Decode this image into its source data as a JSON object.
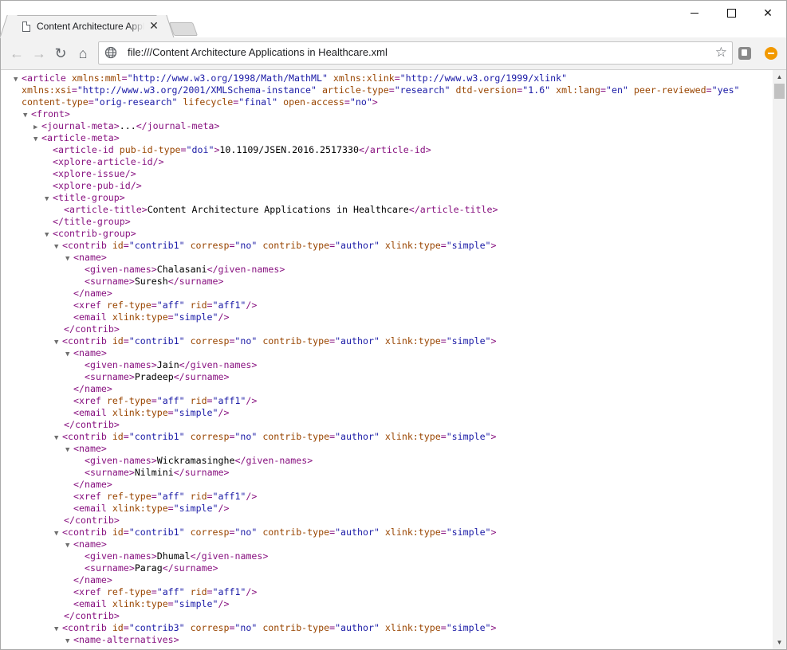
{
  "browser": {
    "tab_title": "Content Architecture Applications in Healthcare.xml",
    "tab_close_glyph": "✕",
    "url": "file:///Content Architecture Applications in Healthcare.xml",
    "star_glyph": "☆",
    "back_glyph": "←",
    "forward_glyph": "→",
    "reload_glyph": "↻",
    "home_glyph": "⌂",
    "close_glyph": "✕",
    "icons": [
      "page-icon",
      "globe-icon",
      "star-icon",
      "extension-icon",
      "orange-extension-icon"
    ]
  },
  "colors": {
    "tag": "#881280",
    "attr_name": "#994500",
    "attr_value": "#1a1aa6",
    "toggle": "#6e6e6e"
  },
  "xml_lines": [
    {
      "toggle": "▼",
      "parts": [
        [
          "t",
          "<article"
        ],
        [
          "a",
          " xmlns:mml"
        ],
        [
          "t",
          "="
        ],
        [
          "v",
          "\"http://www.w3.org/1998/Math/MathML\""
        ],
        [
          "a",
          " xmlns:xlink"
        ],
        [
          "t",
          "="
        ],
        [
          "v",
          "\"http://www.w3.org/1999/xlink\""
        ]
      ]
    },
    {
      "toggle": "",
      "parts": [
        [
          "a",
          "xmlns:xsi"
        ],
        [
          "t",
          "="
        ],
        [
          "v",
          "\"http://www.w3.org/2001/XMLSchema-instance\""
        ],
        [
          "a",
          " article-type"
        ],
        [
          "t",
          "="
        ],
        [
          "v",
          "\"research\""
        ],
        [
          "a",
          " dtd-version"
        ],
        [
          "t",
          "="
        ],
        [
          "v",
          "\"1.6\""
        ],
        [
          "a",
          " xml:lang"
        ],
        [
          "t",
          "="
        ],
        [
          "v",
          "\"en\""
        ],
        [
          "a",
          " peer-reviewed"
        ],
        [
          "t",
          "="
        ],
        [
          "v",
          "\"yes\""
        ]
      ]
    },
    {
      "toggle": "",
      "parts": [
        [
          "a",
          "content-type"
        ],
        [
          "t",
          "="
        ],
        [
          "v",
          "\"orig-research\""
        ],
        [
          "a",
          " lifecycle"
        ],
        [
          "t",
          "="
        ],
        [
          "v",
          "\"final\""
        ],
        [
          "a",
          " open-access"
        ],
        [
          "t",
          "="
        ],
        [
          "v",
          "\"no\""
        ],
        [
          "t",
          ">"
        ]
      ]
    },
    {
      "toggle": "▼",
      "parts": [
        [
          "t",
          "<front>"
        ]
      ]
    },
    {
      "toggle": "▶",
      "parts": [
        [
          "t",
          "<journal-meta>"
        ],
        [
          "x",
          "..."
        ],
        [
          "t",
          "</journal-meta>"
        ]
      ]
    },
    {
      "toggle": "▼",
      "parts": [
        [
          "t",
          "<article-meta>"
        ]
      ]
    },
    {
      "toggle": "",
      "parts": [
        [
          "t",
          "<article-id"
        ],
        [
          "a",
          " pub-id-type"
        ],
        [
          "t",
          "="
        ],
        [
          "v",
          "\"doi\""
        ],
        [
          "t",
          ">"
        ],
        [
          "x",
          "10.1109/JSEN.2016.2517330"
        ],
        [
          "t",
          "</article-id>"
        ]
      ]
    },
    {
      "toggle": "",
      "parts": [
        [
          "t",
          "<xplore-article-id/>"
        ]
      ]
    },
    {
      "toggle": "",
      "parts": [
        [
          "t",
          "<xplore-issue/>"
        ]
      ]
    },
    {
      "toggle": "",
      "parts": [
        [
          "t",
          "<xplore-pub-id/>"
        ]
      ]
    },
    {
      "toggle": "▼",
      "parts": [
        [
          "t",
          "<title-group>"
        ]
      ]
    },
    {
      "toggle": "",
      "parts": [
        [
          "t",
          "<article-title>"
        ],
        [
          "x",
          "Content Architecture Applications in Healthcare"
        ],
        [
          "t",
          "</article-title>"
        ]
      ]
    },
    {
      "toggle": "",
      "parts": [
        [
          "t",
          "</title-group>"
        ]
      ]
    },
    {
      "toggle": "▼",
      "parts": [
        [
          "t",
          "<contrib-group>"
        ]
      ]
    },
    {
      "toggle": "▼",
      "parts": [
        [
          "t",
          "<contrib"
        ],
        [
          "a",
          " id"
        ],
        [
          "t",
          "="
        ],
        [
          "v",
          "\"contrib1\""
        ],
        [
          "a",
          " corresp"
        ],
        [
          "t",
          "="
        ],
        [
          "v",
          "\"no\""
        ],
        [
          "a",
          " contrib-type"
        ],
        [
          "t",
          "="
        ],
        [
          "v",
          "\"author\""
        ],
        [
          "a",
          " xlink:type"
        ],
        [
          "t",
          "="
        ],
        [
          "v",
          "\"simple\""
        ],
        [
          "t",
          ">"
        ]
      ]
    },
    {
      "toggle": "▼",
      "parts": [
        [
          "t",
          "<name>"
        ]
      ]
    },
    {
      "toggle": "",
      "parts": [
        [
          "t",
          "<given-names>"
        ],
        [
          "x",
          "Chalasani"
        ],
        [
          "t",
          "</given-names>"
        ]
      ]
    },
    {
      "toggle": "",
      "parts": [
        [
          "t",
          "<surname>"
        ],
        [
          "x",
          "Suresh"
        ],
        [
          "t",
          "</surname>"
        ]
      ]
    },
    {
      "toggle": "",
      "parts": [
        [
          "t",
          "</name>"
        ]
      ]
    },
    {
      "toggle": "",
      "parts": [
        [
          "t",
          "<xref"
        ],
        [
          "a",
          " ref-type"
        ],
        [
          "t",
          "="
        ],
        [
          "v",
          "\"aff\""
        ],
        [
          "a",
          " rid"
        ],
        [
          "t",
          "="
        ],
        [
          "v",
          "\"aff1\""
        ],
        [
          "t",
          "/>"
        ]
      ]
    },
    {
      "toggle": "",
      "parts": [
        [
          "t",
          "<email"
        ],
        [
          "a",
          " xlink:type"
        ],
        [
          "t",
          "="
        ],
        [
          "v",
          "\"simple\""
        ],
        [
          "t",
          "/>"
        ]
      ]
    },
    {
      "toggle": "",
      "parts": [
        [
          "t",
          "</contrib>"
        ]
      ]
    },
    {
      "toggle": "▼",
      "parts": [
        [
          "t",
          "<contrib"
        ],
        [
          "a",
          " id"
        ],
        [
          "t",
          "="
        ],
        [
          "v",
          "\"contrib1\""
        ],
        [
          "a",
          " corresp"
        ],
        [
          "t",
          "="
        ],
        [
          "v",
          "\"no\""
        ],
        [
          "a",
          " contrib-type"
        ],
        [
          "t",
          "="
        ],
        [
          "v",
          "\"author\""
        ],
        [
          "a",
          " xlink:type"
        ],
        [
          "t",
          "="
        ],
        [
          "v",
          "\"simple\""
        ],
        [
          "t",
          ">"
        ]
      ]
    },
    {
      "toggle": "▼",
      "parts": [
        [
          "t",
          "<name>"
        ]
      ]
    },
    {
      "toggle": "",
      "parts": [
        [
          "t",
          "<given-names>"
        ],
        [
          "x",
          "Jain"
        ],
        [
          "t",
          "</given-names>"
        ]
      ]
    },
    {
      "toggle": "",
      "parts": [
        [
          "t",
          "<surname>"
        ],
        [
          "x",
          "Pradeep"
        ],
        [
          "t",
          "</surname>"
        ]
      ]
    },
    {
      "toggle": "",
      "parts": [
        [
          "t",
          "</name>"
        ]
      ]
    },
    {
      "toggle": "",
      "parts": [
        [
          "t",
          "<xref"
        ],
        [
          "a",
          " ref-type"
        ],
        [
          "t",
          "="
        ],
        [
          "v",
          "\"aff\""
        ],
        [
          "a",
          " rid"
        ],
        [
          "t",
          "="
        ],
        [
          "v",
          "\"aff1\""
        ],
        [
          "t",
          "/>"
        ]
      ]
    },
    {
      "toggle": "",
      "parts": [
        [
          "t",
          "<email"
        ],
        [
          "a",
          " xlink:type"
        ],
        [
          "t",
          "="
        ],
        [
          "v",
          "\"simple\""
        ],
        [
          "t",
          "/>"
        ]
      ]
    },
    {
      "toggle": "",
      "parts": [
        [
          "t",
          "</contrib>"
        ]
      ]
    },
    {
      "toggle": "▼",
      "parts": [
        [
          "t",
          "<contrib"
        ],
        [
          "a",
          " id"
        ],
        [
          "t",
          "="
        ],
        [
          "v",
          "\"contrib1\""
        ],
        [
          "a",
          " corresp"
        ],
        [
          "t",
          "="
        ],
        [
          "v",
          "\"no\""
        ],
        [
          "a",
          " contrib-type"
        ],
        [
          "t",
          "="
        ],
        [
          "v",
          "\"author\""
        ],
        [
          "a",
          " xlink:type"
        ],
        [
          "t",
          "="
        ],
        [
          "v",
          "\"simple\""
        ],
        [
          "t",
          ">"
        ]
      ]
    },
    {
      "toggle": "▼",
      "parts": [
        [
          "t",
          "<name>"
        ]
      ]
    },
    {
      "toggle": "",
      "parts": [
        [
          "t",
          "<given-names>"
        ],
        [
          "x",
          "Wickramasinghe"
        ],
        [
          "t",
          "</given-names>"
        ]
      ]
    },
    {
      "toggle": "",
      "parts": [
        [
          "t",
          "<surname>"
        ],
        [
          "x",
          "Nilmini"
        ],
        [
          "t",
          "</surname>"
        ]
      ]
    },
    {
      "toggle": "",
      "parts": [
        [
          "t",
          "</name>"
        ]
      ]
    },
    {
      "toggle": "",
      "parts": [
        [
          "t",
          "<xref"
        ],
        [
          "a",
          " ref-type"
        ],
        [
          "t",
          "="
        ],
        [
          "v",
          "\"aff\""
        ],
        [
          "a",
          " rid"
        ],
        [
          "t",
          "="
        ],
        [
          "v",
          "\"aff1\""
        ],
        [
          "t",
          "/>"
        ]
      ]
    },
    {
      "toggle": "",
      "parts": [
        [
          "t",
          "<email"
        ],
        [
          "a",
          " xlink:type"
        ],
        [
          "t",
          "="
        ],
        [
          "v",
          "\"simple\""
        ],
        [
          "t",
          "/>"
        ]
      ]
    },
    {
      "toggle": "",
      "parts": [
        [
          "t",
          "</contrib>"
        ]
      ]
    },
    {
      "toggle": "▼",
      "parts": [
        [
          "t",
          "<contrib"
        ],
        [
          "a",
          " id"
        ],
        [
          "t",
          "="
        ],
        [
          "v",
          "\"contrib1\""
        ],
        [
          "a",
          " corresp"
        ],
        [
          "t",
          "="
        ],
        [
          "v",
          "\"no\""
        ],
        [
          "a",
          " contrib-type"
        ],
        [
          "t",
          "="
        ],
        [
          "v",
          "\"author\""
        ],
        [
          "a",
          " xlink:type"
        ],
        [
          "t",
          "="
        ],
        [
          "v",
          "\"simple\""
        ],
        [
          "t",
          ">"
        ]
      ]
    },
    {
      "toggle": "▼",
      "parts": [
        [
          "t",
          "<name>"
        ]
      ]
    },
    {
      "toggle": "",
      "parts": [
        [
          "t",
          "<given-names>"
        ],
        [
          "x",
          "Dhumal"
        ],
        [
          "t",
          "</given-names>"
        ]
      ]
    },
    {
      "toggle": "",
      "parts": [
        [
          "t",
          "<surname>"
        ],
        [
          "x",
          "Parag"
        ],
        [
          "t",
          "</surname>"
        ]
      ]
    },
    {
      "toggle": "",
      "parts": [
        [
          "t",
          "</name>"
        ]
      ]
    },
    {
      "toggle": "",
      "parts": [
        [
          "t",
          "<xref"
        ],
        [
          "a",
          " ref-type"
        ],
        [
          "t",
          "="
        ],
        [
          "v",
          "\"aff\""
        ],
        [
          "a",
          " rid"
        ],
        [
          "t",
          "="
        ],
        [
          "v",
          "\"aff1\""
        ],
        [
          "t",
          "/>"
        ]
      ]
    },
    {
      "toggle": "",
      "parts": [
        [
          "t",
          "<email"
        ],
        [
          "a",
          " xlink:type"
        ],
        [
          "t",
          "="
        ],
        [
          "v",
          "\"simple\""
        ],
        [
          "t",
          "/>"
        ]
      ]
    },
    {
      "toggle": "",
      "parts": [
        [
          "t",
          "</contrib>"
        ]
      ]
    },
    {
      "toggle": "▼",
      "parts": [
        [
          "t",
          "<contrib"
        ],
        [
          "a",
          " id"
        ],
        [
          "t",
          "="
        ],
        [
          "v",
          "\"contrib3\""
        ],
        [
          "a",
          " corresp"
        ],
        [
          "t",
          "="
        ],
        [
          "v",
          "\"no\""
        ],
        [
          "a",
          " contrib-type"
        ],
        [
          "t",
          "="
        ],
        [
          "v",
          "\"author\""
        ],
        [
          "a",
          " xlink:type"
        ],
        [
          "t",
          "="
        ],
        [
          "v",
          "\"simple\""
        ],
        [
          "t",
          ">"
        ]
      ]
    },
    {
      "toggle": "▼",
      "parts": [
        [
          "t",
          "<name-alternatives>"
        ]
      ]
    }
  ]
}
